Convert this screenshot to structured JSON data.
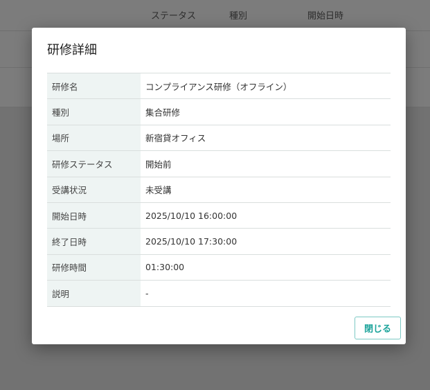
{
  "background": {
    "columns": [
      "ステータス",
      "種別",
      "開始日時"
    ]
  },
  "modal": {
    "title": "研修詳細",
    "rows": [
      {
        "label": "研修名",
        "value": "コンプライアンス研修（オフライン）"
      },
      {
        "label": "種別",
        "value": "集合研修"
      },
      {
        "label": "場所",
        "value": "新宿貸オフィス"
      },
      {
        "label": "研修ステータス",
        "value": "開始前"
      },
      {
        "label": "受講状況",
        "value": "未受講"
      },
      {
        "label": "開始日時",
        "value": "2025/10/10 16:00:00"
      },
      {
        "label": "終了日時",
        "value": "2025/10/10 17:30:00"
      },
      {
        "label": "研修時間",
        "value": "01:30:00"
      },
      {
        "label": "説明",
        "value": "-"
      }
    ],
    "close_label": "閉じる"
  },
  "colors": {
    "accent": "#1aa39a",
    "label_bg": "#eef4f3",
    "overlay": "#7b7b7b"
  }
}
